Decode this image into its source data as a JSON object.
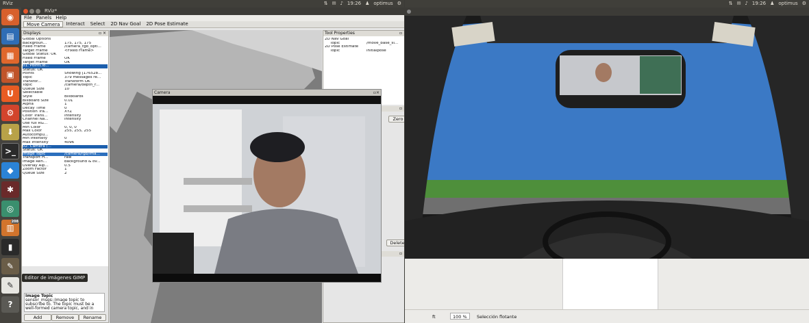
{
  "left_topbar": {
    "app_title": "RViz",
    "clock": "19:26",
    "user": "optimus"
  },
  "right_topbar": {
    "clock": "19:26",
    "user": "optimus"
  },
  "launcher": {
    "tooltip": "Editor de imágenes GIMP",
    "badge": "208"
  },
  "rviz": {
    "window_title": "RViz*",
    "menu": [
      "File",
      "Panels",
      "Help"
    ],
    "tools": [
      "Move Camera",
      "Interact",
      "Select",
      "2D Nav Goal",
      "2D Pose Estimate"
    ],
    "displays_title": "Displays",
    "tool_props_title": "Tool Properties",
    "tool_props": [
      {
        "k": "2D Nav Goal",
        "v": ""
      },
      {
        "k": "Topic",
        "v": "/move_base_si..."
      },
      {
        "k": "2D Pose Estimate",
        "v": ""
      },
      {
        "k": "Topic",
        "v": "initialpose"
      }
    ],
    "tree": [
      {
        "k": "Global Options",
        "v": ""
      },
      {
        "k": "Backgroun...",
        "v": "175, 175, 175"
      },
      {
        "k": "Fixed Frame",
        "v": "/camera_rgb_opti..."
      },
      {
        "k": "Target Frame",
        "v": "<Fixed Frame>"
      },
      {
        "k": "Global Status: OK",
        "v": ""
      },
      {
        "k": "Fixed Frame",
        "v": "OK"
      },
      {
        "k": "Target Frame",
        "v": "OK"
      },
      {
        "k": "01. PointClo...",
        "v": "",
        "sel": true
      },
      {
        "k": "Status: OK",
        "v": ""
      },
      {
        "k": "Points",
        "v": "Showing [176528..."
      },
      {
        "k": "Topic",
        "v": "379 messages re..."
      },
      {
        "k": "Transfor...",
        "v": "Transform OK"
      },
      {
        "k": "Topic",
        "v": "/camera/depth_r..."
      },
      {
        "k": "Queue Size",
        "v": "10"
      },
      {
        "k": "Selectable",
        "v": ""
      },
      {
        "k": "Style",
        "v": "Billboards"
      },
      {
        "k": "Billboard Size",
        "v": "0.01"
      },
      {
        "k": "Alpha",
        "v": "1"
      },
      {
        "k": "Decay Time",
        "v": "0"
      },
      {
        "k": "Position Tra...",
        "v": "XYZ"
      },
      {
        "k": "Color Trans...",
        "v": "Intensity"
      },
      {
        "k": "Channel Na...",
        "v": "intensity"
      },
      {
        "k": "Use full RG...",
        "v": ""
      },
      {
        "k": "Min Color",
        "v": "0, 0, 0"
      },
      {
        "k": "Max Color",
        "v": "255, 255, 255"
      },
      {
        "k": "Autocompu...",
        "v": ""
      },
      {
        "k": "Min Intensity",
        "v": "0"
      },
      {
        "k": "Max Intensity",
        "v": "4096"
      },
      {
        "k": "02. Camera (...",
        "v": "",
        "sel": true
      },
      {
        "k": "Status: OK",
        "v": ""
      },
      {
        "k": "Image Topic",
        "v": "/camera/rgb/ima...",
        "sel2": true
      },
      {
        "k": "Transport H...",
        "v": "raw"
      },
      {
        "k": "Image Ren...",
        "v": "background & ov..."
      },
      {
        "k": "Overlay Alp...",
        "v": "0.5"
      },
      {
        "k": "Zoom Factor",
        "v": "1"
      },
      {
        "k": "Queue Size",
        "v": "2"
      }
    ],
    "help_title": "Image Topic",
    "help_text": "sensor_msgs::Image topic to subscribe to. The topic must be a well-formed camera topic, and in",
    "buttons": {
      "add": "Add",
      "remove": "Remove",
      "rename": "Rename"
    },
    "zero_label": "Zero",
    "delete_label": "Delete",
    "camera_title": "Camera"
  },
  "gimp": {
    "zoom_unit": "ft",
    "zoom": "100 %",
    "status": "Selección flotante"
  }
}
